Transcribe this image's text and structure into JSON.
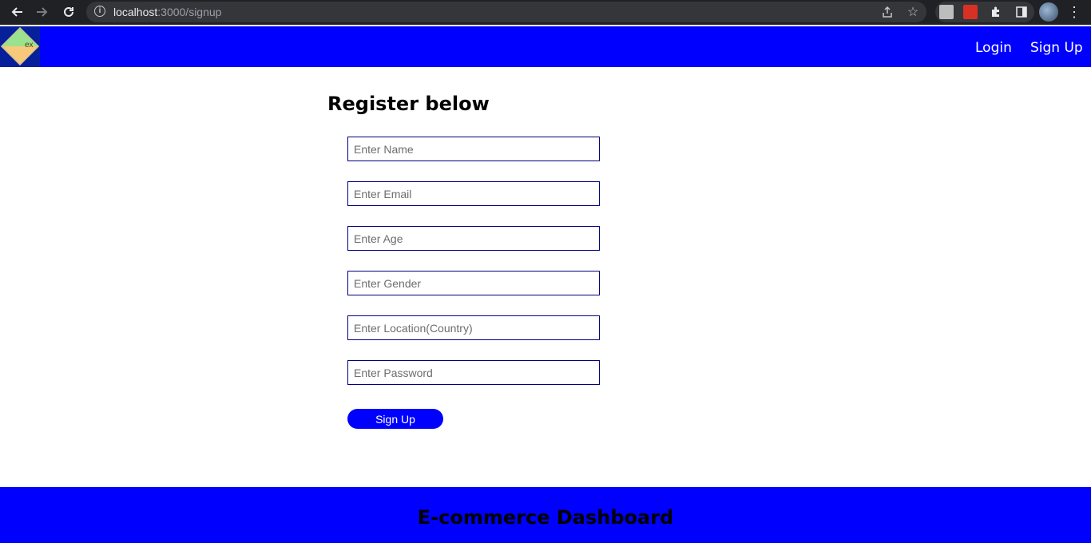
{
  "browser": {
    "url_host": "localhost",
    "url_path": ":3000/signup",
    "icons": [
      "back-icon",
      "forward-icon",
      "reload-icon",
      "info-icon",
      "share-icon",
      "star-icon",
      "extension-icon",
      "pdf-extension-icon",
      "puzzle-icon",
      "sidepanel-icon",
      "profile-avatar",
      "kebab-menu-icon"
    ]
  },
  "nav": {
    "logo_text": "ex",
    "links": [
      {
        "label": "Login"
      },
      {
        "label": "Sign Up"
      }
    ],
    "background": "#0000ff"
  },
  "form": {
    "title": "Register below",
    "fields": [
      {
        "placeholder": "Enter Name",
        "value": ""
      },
      {
        "placeholder": "Enter Email",
        "value": ""
      },
      {
        "placeholder": "Enter Age",
        "value": ""
      },
      {
        "placeholder": "Enter Gender",
        "value": ""
      },
      {
        "placeholder": "Enter Location(Country)",
        "value": ""
      },
      {
        "placeholder": "Enter Password",
        "value": ""
      }
    ],
    "submit_label": "Sign Up",
    "accent": "#0000ff",
    "field_border": "#000080"
  },
  "footer": {
    "title": "E-commerce Dashboard",
    "background": "#0000ff"
  }
}
